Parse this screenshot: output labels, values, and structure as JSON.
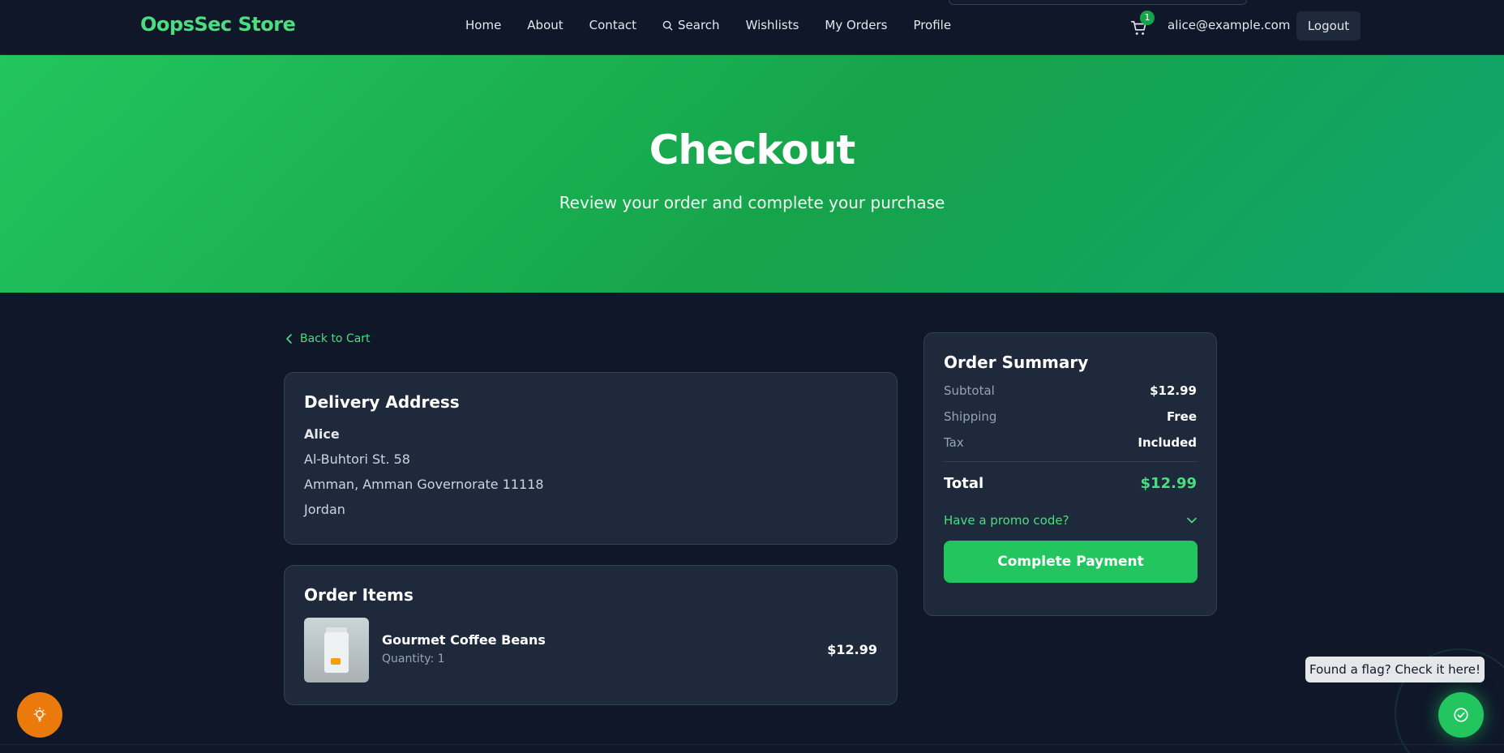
{
  "nav": {
    "brand": "OopsSec Store",
    "links": [
      {
        "label": "Home"
      },
      {
        "label": "About"
      },
      {
        "label": "Contact"
      },
      {
        "label": "Search"
      },
      {
        "label": "Wishlists"
      },
      {
        "label": "My Orders"
      },
      {
        "label": "Profile"
      }
    ],
    "cart_count": "1",
    "user_email": "alice@example.com",
    "logout_label": "Logout",
    "icons": {
      "cart": "cart-icon",
      "search": "search-icon"
    }
  },
  "hero": {
    "title": "Checkout",
    "subtitle": "Review your order and complete your purchase",
    "gradient_colors": [
      "#22c55e",
      "#16a34a",
      "#10a56f"
    ]
  },
  "back_link": "Back to Cart",
  "address": {
    "title": "Delivery Address",
    "name": "Alice",
    "street": "Al-Buhtori St. 58",
    "city_line": "Amman, Amman Governorate 11118",
    "country": "Jordan"
  },
  "order_items": {
    "title": "Order Items",
    "items": [
      {
        "name": "Gourmet Coffee Beans",
        "quantity_text": "Quantity: 1",
        "price": "$12.99"
      }
    ]
  },
  "summary": {
    "title": "Order Summary",
    "rows": [
      {
        "label": "Subtotal",
        "value": "$12.99"
      },
      {
        "label": "Shipping",
        "value": "Free"
      },
      {
        "label": "Tax",
        "value": "Included"
      }
    ],
    "total_label": "Total",
    "total_value": "$12.99",
    "promo_label": "Have a promo code?",
    "pay_label": "Complete Payment"
  },
  "floating": {
    "flag_tooltip": "Found a flag? Check it here!",
    "hint_icon": "lightbulb-icon",
    "flag_icon": "check-circle-icon"
  },
  "colors": {
    "background": "#0f1729",
    "card": "#1e293b",
    "accent": "#22c55e",
    "accent_text": "#4ade80",
    "hint_orange": "#ea7a0c"
  }
}
